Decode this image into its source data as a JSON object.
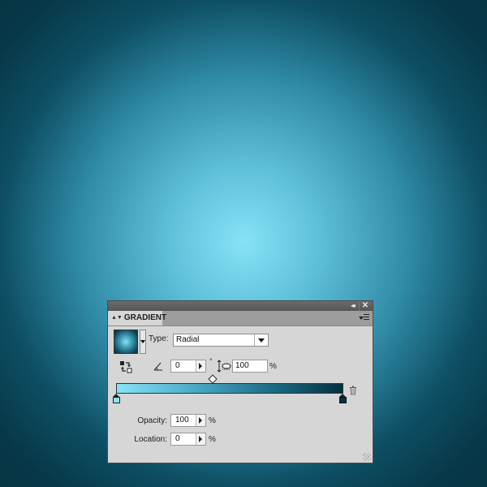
{
  "panel": {
    "tab_label": "GRADIENT",
    "collapse_icon": "◂◂",
    "close_icon": "✕",
    "type_label": "Type:",
    "type_value": "Radial",
    "angle_value": "0",
    "degree_symbol": "°",
    "aspect_value": "100",
    "percent_symbol": "%",
    "opacity_label": "Opacity:",
    "opacity_value": "100",
    "location_label": "Location:",
    "location_value": "0"
  },
  "colors": {
    "gradient_center": "#86e3f7",
    "gradient_edge": "#06313f"
  },
  "icons": [
    "collapse-icon",
    "close-icon",
    "panel-menu-icon",
    "reverse-gradient-icon",
    "angle-icon",
    "aspect-ratio-icon",
    "trash-icon",
    "resize-grip-icon"
  ]
}
